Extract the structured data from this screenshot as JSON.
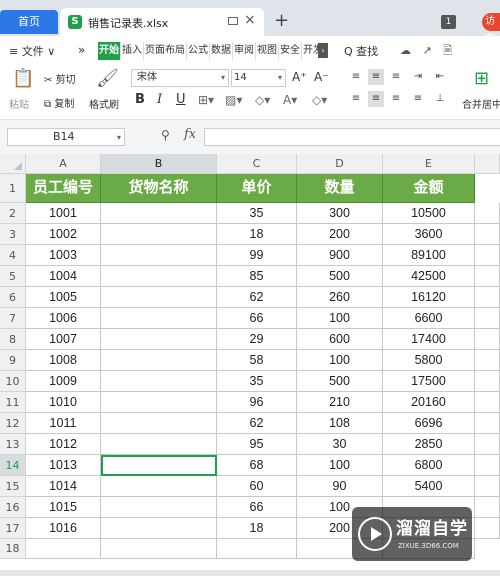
{
  "tabs": {
    "home": "首页",
    "doc_icon": "S",
    "doc_title": "销售记录表.xlsx",
    "add": "+",
    "badge": "1",
    "visitor": "访客"
  },
  "menu": {
    "file": "≡ 文件 ∨",
    "more_arrow": "»",
    "tabs": [
      "开始",
      "插入",
      "页面布局",
      "公式",
      "数据",
      "审阅",
      "视图",
      "安全",
      "开发"
    ],
    "active_tab": "开始",
    "search": "Q 查找",
    "right_icons": "☁ ↗ 🗎"
  },
  "ribbon": {
    "paste": "粘贴",
    "cut": "剪切",
    "copy": "复制",
    "format_painter": "格式刷",
    "font_name": "宋体",
    "font_size": "14",
    "bold": "B",
    "italic": "I",
    "underline": "U",
    "grow": "A⁺",
    "shrink": "A⁻",
    "merge_center": "合并居中"
  },
  "formula_bar": {
    "name_box": "B14",
    "fx": "fx",
    "formula": ""
  },
  "sheet": {
    "columns": [
      "A",
      "B",
      "C",
      "D",
      "E"
    ],
    "selected_column": "B",
    "selected_row": "14",
    "row_numbers": [
      "1",
      "2",
      "3",
      "4",
      "5",
      "6",
      "7",
      "8",
      "9",
      "10",
      "11",
      "12",
      "13",
      "14",
      "15",
      "16",
      "17",
      "18"
    ],
    "header": [
      "员工编号",
      "货物名称",
      "单价",
      "数量",
      "金额"
    ],
    "rows": [
      [
        "1001",
        "",
        "35",
        "300",
        "10500"
      ],
      [
        "1002",
        "",
        "18",
        "200",
        "3600"
      ],
      [
        "1003",
        "",
        "99",
        "900",
        "89100"
      ],
      [
        "1004",
        "",
        "85",
        "500",
        "42500"
      ],
      [
        "1005",
        "",
        "62",
        "260",
        "16120"
      ],
      [
        "1006",
        "",
        "66",
        "100",
        "6600"
      ],
      [
        "1007",
        "",
        "29",
        "600",
        "17400"
      ],
      [
        "1008",
        "",
        "58",
        "100",
        "5800"
      ],
      [
        "1009",
        "",
        "35",
        "500",
        "17500"
      ],
      [
        "1010",
        "",
        "96",
        "210",
        "20160"
      ],
      [
        "1011",
        "",
        "62",
        "108",
        "6696"
      ],
      [
        "1012",
        "",
        "95",
        "30",
        "2850"
      ],
      [
        "1013",
        "",
        "68",
        "100",
        "6800"
      ],
      [
        "1014",
        "",
        "60",
        "90",
        "5400"
      ],
      [
        "1015",
        "",
        "66",
        "100",
        ""
      ],
      [
        "1016",
        "",
        "18",
        "200",
        ""
      ]
    ]
  },
  "watermark": {
    "title": "溜溜自学",
    "url": "ZIXUE.3D66.COM"
  }
}
